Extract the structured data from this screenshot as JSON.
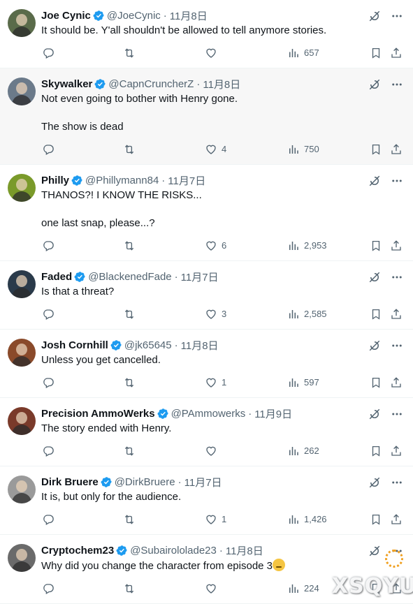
{
  "colors": {
    "verified": "#1d9bf0",
    "muted": "#536471",
    "text": "#0f1419",
    "hover_bg": "#f7f7f7",
    "divider": "#eff3f4"
  },
  "icons": {
    "verified": "verified-badge-icon",
    "grok": "grok-icon",
    "more": "more-dots-icon",
    "reply": "reply-icon",
    "retweet": "retweet-icon",
    "like": "heart-icon",
    "views": "views-chart-icon",
    "bookmark": "bookmark-icon",
    "share": "share-icon"
  },
  "tweets": [
    {
      "name": "Joe Cynic",
      "handle": "@JoeCynic",
      "date": "11月8日",
      "lines": [
        "It should be. Y'all shouldn't be allowed to tell anymore stories."
      ],
      "replies": "",
      "retweets": "",
      "likes": "",
      "views": "657",
      "avatar_color": "#5a6b4a"
    },
    {
      "name": "Skywalker",
      "handle": "@CapnCruncherZ",
      "date": "11月8日",
      "lines": [
        "Not even going to bother with Henry gone.",
        "The show is dead"
      ],
      "replies": "",
      "retweets": "",
      "likes": "4",
      "views": "750",
      "avatar_color": "#6b7a8a"
    },
    {
      "name": "Philly",
      "handle": "@Phillymann84",
      "date": "11月7日",
      "lines": [
        "THANOS?! I KNOW THE RISKS...",
        "one last snap, please...?"
      ],
      "replies": "",
      "retweets": "",
      "likes": "6",
      "views": "2,953",
      "avatar_color": "#7a9a2a"
    },
    {
      "name": "Faded",
      "handle": "@BlackenedFade",
      "date": "11月7日",
      "lines": [
        "Is that a threat?"
      ],
      "replies": "",
      "retweets": "",
      "likes": "3",
      "views": "2,585",
      "avatar_color": "#2a3a4a"
    },
    {
      "name": "Josh Cornhill",
      "handle": "@jk65645",
      "date": "11月8日",
      "lines": [
        "Unless you get cancelled."
      ],
      "replies": "",
      "retweets": "",
      "likes": "1",
      "views": "597",
      "avatar_color": "#8a4a2a"
    },
    {
      "name": "Precision AmmoWerks",
      "handle": "@PAmmowerks",
      "date": "11月9日",
      "lines": [
        "The story ended with Henry."
      ],
      "replies": "",
      "retweets": "",
      "likes": "",
      "views": "262",
      "avatar_color": "#7a3a2a"
    },
    {
      "name": "Dirk Bruere",
      "handle": "@DirkBruere",
      "date": "11月7日",
      "lines": [
        "It is, but only for the audience."
      ],
      "replies": "",
      "retweets": "",
      "likes": "1",
      "views": "1,426",
      "avatar_color": "#9a9a9a"
    },
    {
      "name": "Cryptochem23",
      "handle": "@Subairololade23",
      "date": "11月8日",
      "lines": [
        "Why did you change the character from episode 3"
      ],
      "replies": "",
      "retweets": "",
      "likes": "",
      "views": "224",
      "avatar_color": "#6a6a6a"
    }
  ],
  "watermark": "XSQYU"
}
